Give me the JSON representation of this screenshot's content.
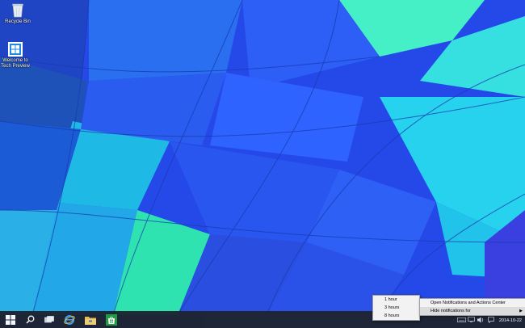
{
  "desktop": {
    "icons": [
      {
        "label": "Recycle Bin"
      },
      {
        "label_line1": "Welcome to",
        "label_line2": "Tech Preview"
      }
    ]
  },
  "taskbar": {
    "pinned": [
      "start-icon",
      "search-icon",
      "task-view-icon",
      "internet-explorer-icon",
      "file-explorer-icon",
      "store-icon"
    ],
    "clock": {
      "date": "2014-10-22"
    }
  },
  "context_menu": {
    "items": [
      {
        "label": "Open Notifications and Actions Center"
      },
      {
        "label": "Hide notifications for",
        "has_submenu": true
      }
    ]
  },
  "submenu": {
    "items": [
      {
        "label": "1 hour"
      },
      {
        "label": "3 hours"
      },
      {
        "label": "8 hours"
      }
    ]
  },
  "colors": {
    "taskbar": "#1e2430",
    "menu_bg": "#f2f2f2",
    "accent_green": "#1f9f3a",
    "windows_blue": "#1e8be0"
  }
}
